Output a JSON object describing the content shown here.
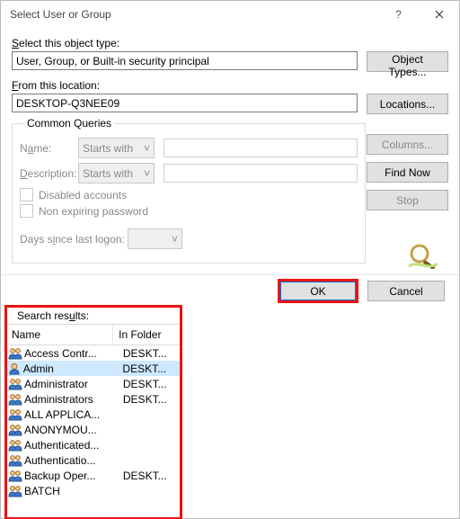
{
  "title": "Select User or Group",
  "objectType": {
    "label": "Select this object type:",
    "value": "User, Group, or Built-in security principal",
    "button": "Object Types..."
  },
  "location": {
    "label": "From this location:",
    "value": "DESKTOP-Q3NEE09",
    "button": "Locations..."
  },
  "commonQueries": {
    "legend": "Common Queries",
    "nameLabel": "Name:",
    "nameMode": "Starts with",
    "descLabel": "Description:",
    "descMode": "Starts with",
    "disabledAccounts": "Disabled accounts",
    "nonExpiring": "Non expiring password",
    "daysSince": "Days since last logon:"
  },
  "buttons": {
    "columns": "Columns...",
    "findNow": "Find Now",
    "stop": "Stop",
    "ok": "OK",
    "cancel": "Cancel"
  },
  "results": {
    "label": "Search results:",
    "headers": {
      "name": "Name",
      "folder": "In Folder"
    },
    "rows": [
      {
        "icon": "group",
        "name": "Access Contr...",
        "folder": "DESKT...",
        "selected": false
      },
      {
        "icon": "user",
        "name": "Admin",
        "folder": "DESKT...",
        "selected": true
      },
      {
        "icon": "group",
        "name": "Administrator",
        "folder": "DESKT...",
        "selected": false
      },
      {
        "icon": "group",
        "name": "Administrators",
        "folder": "DESKT...",
        "selected": false
      },
      {
        "icon": "group",
        "name": "ALL APPLICA...",
        "folder": "",
        "selected": false
      },
      {
        "icon": "group",
        "name": "ANONYMOU...",
        "folder": "",
        "selected": false
      },
      {
        "icon": "group",
        "name": "Authenticated...",
        "folder": "",
        "selected": false
      },
      {
        "icon": "group",
        "name": "Authenticatio...",
        "folder": "",
        "selected": false
      },
      {
        "icon": "group",
        "name": "Backup Oper...",
        "folder": "DESKT...",
        "selected": false
      },
      {
        "icon": "group",
        "name": "BATCH",
        "folder": "",
        "selected": false
      }
    ]
  }
}
